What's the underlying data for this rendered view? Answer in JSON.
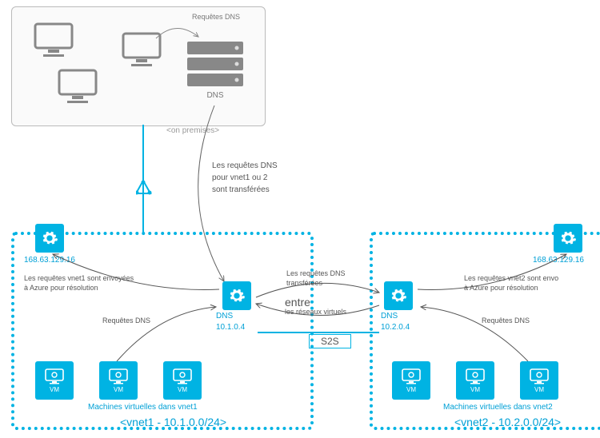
{
  "onprem": {
    "label": "<on premises>",
    "dns_label": "DNS",
    "req_label": "Requêtes DNS"
  },
  "forward_text": {
    "l1": "Les requêtes DNS",
    "l2": "pour vnet1 ou 2",
    "l3": "sont transférées"
  },
  "center": {
    "fwd1": "Les requêtes DNS",
    "fwd2": "transférées",
    "entre": "entre",
    "entre_sub": "les réseaux virtuels",
    "s2s": "S2S"
  },
  "vnet1": {
    "azure_ip": "168.63.129.16",
    "dns_label": "DNS",
    "dns_ip": "10.1.0.4",
    "req": "Requêtes DNS",
    "to_azure": "Les requêtes vnet1 sont envoyées\nà Azure pour résolution",
    "vm_group": "Machines virtuelles dans vnet1",
    "footer": "<vnet1 -  10.1.0.0/24>"
  },
  "vnet2": {
    "azure_ip": "168.63.129.16",
    "dns_label": "DNS",
    "dns_ip": "10.2.0.4",
    "req": "Requêtes DNS",
    "to_azure": "Les requêtes vnet2 sont envo\nà Azure pour résolution",
    "vm_group": "Machines virtuelles dans vnet2",
    "footer": "<vnet2 -  10.2.0.0/24>"
  },
  "vm_label": "VM"
}
